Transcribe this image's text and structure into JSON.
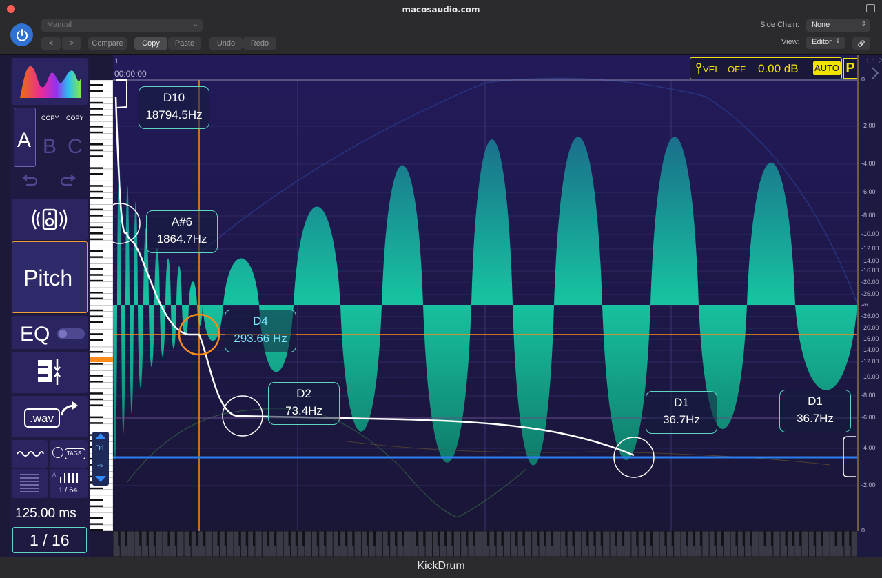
{
  "window": {
    "title": "macosaudio.com",
    "plugin_name": "KickDrum"
  },
  "toolbar": {
    "preset": "Manual",
    "compare": "Compare",
    "copy": "Copy",
    "paste": "Paste",
    "undo": "Undo",
    "redo": "Redo",
    "side_chain_label": "Side Chain:",
    "side_chain_value": "None",
    "view_label": "View:",
    "view_value": "Editor"
  },
  "left_panel": {
    "slot_a": "A",
    "slot_b": "B",
    "slot_c": "C",
    "copy_1": "COPY",
    "copy_2": "COPY",
    "mode": "Pitch",
    "eq": "EQ",
    "wav": ".wav",
    "tags": "TAGS",
    "grid_fraction": "1 / 64",
    "grid_prefix": "A",
    "time": "125.00 ms",
    "snap": "1 / 16",
    "note_badge": "D1",
    "oct_badge": "+5"
  },
  "timeline": {
    "bar": "1",
    "time": "00:00:00",
    "right_bar": "1.1.2"
  },
  "velocity": {
    "label": "VEL",
    "state": "OFF",
    "db": "0.00 dB",
    "auto": "AUTO",
    "p": "P"
  },
  "notes": [
    {
      "name": "D10",
      "freq": "18794.5Hz"
    },
    {
      "name": "A#6",
      "freq": "1864.7Hz"
    },
    {
      "name": "D4",
      "freq": "293.66 Hz"
    },
    {
      "name": "D2",
      "freq": "73.4Hz"
    },
    {
      "name": "D1",
      "freq": "36.7Hz"
    },
    {
      "name": "D1",
      "freq": "36.7Hz"
    }
  ],
  "axis_ticks": [
    "0",
    "-2.00",
    "-4.00",
    "-6.00",
    "-8.00",
    "-10.00",
    "-12.00",
    "-14.00",
    "-16.00",
    "-20.00",
    "-26.00",
    "-∞",
    "-26.00",
    "-20.00",
    "-16.00",
    "-14.00",
    "-12.00",
    "-10.00",
    "-8.00",
    "-6.00",
    "-4.00",
    "-2.00",
    "0"
  ],
  "colors": {
    "accent": "#2f72d4",
    "wave": "#17c3a0",
    "highlight": "#f2e200",
    "marker": "#ff8c1a",
    "baseline": "#2c7df0"
  }
}
